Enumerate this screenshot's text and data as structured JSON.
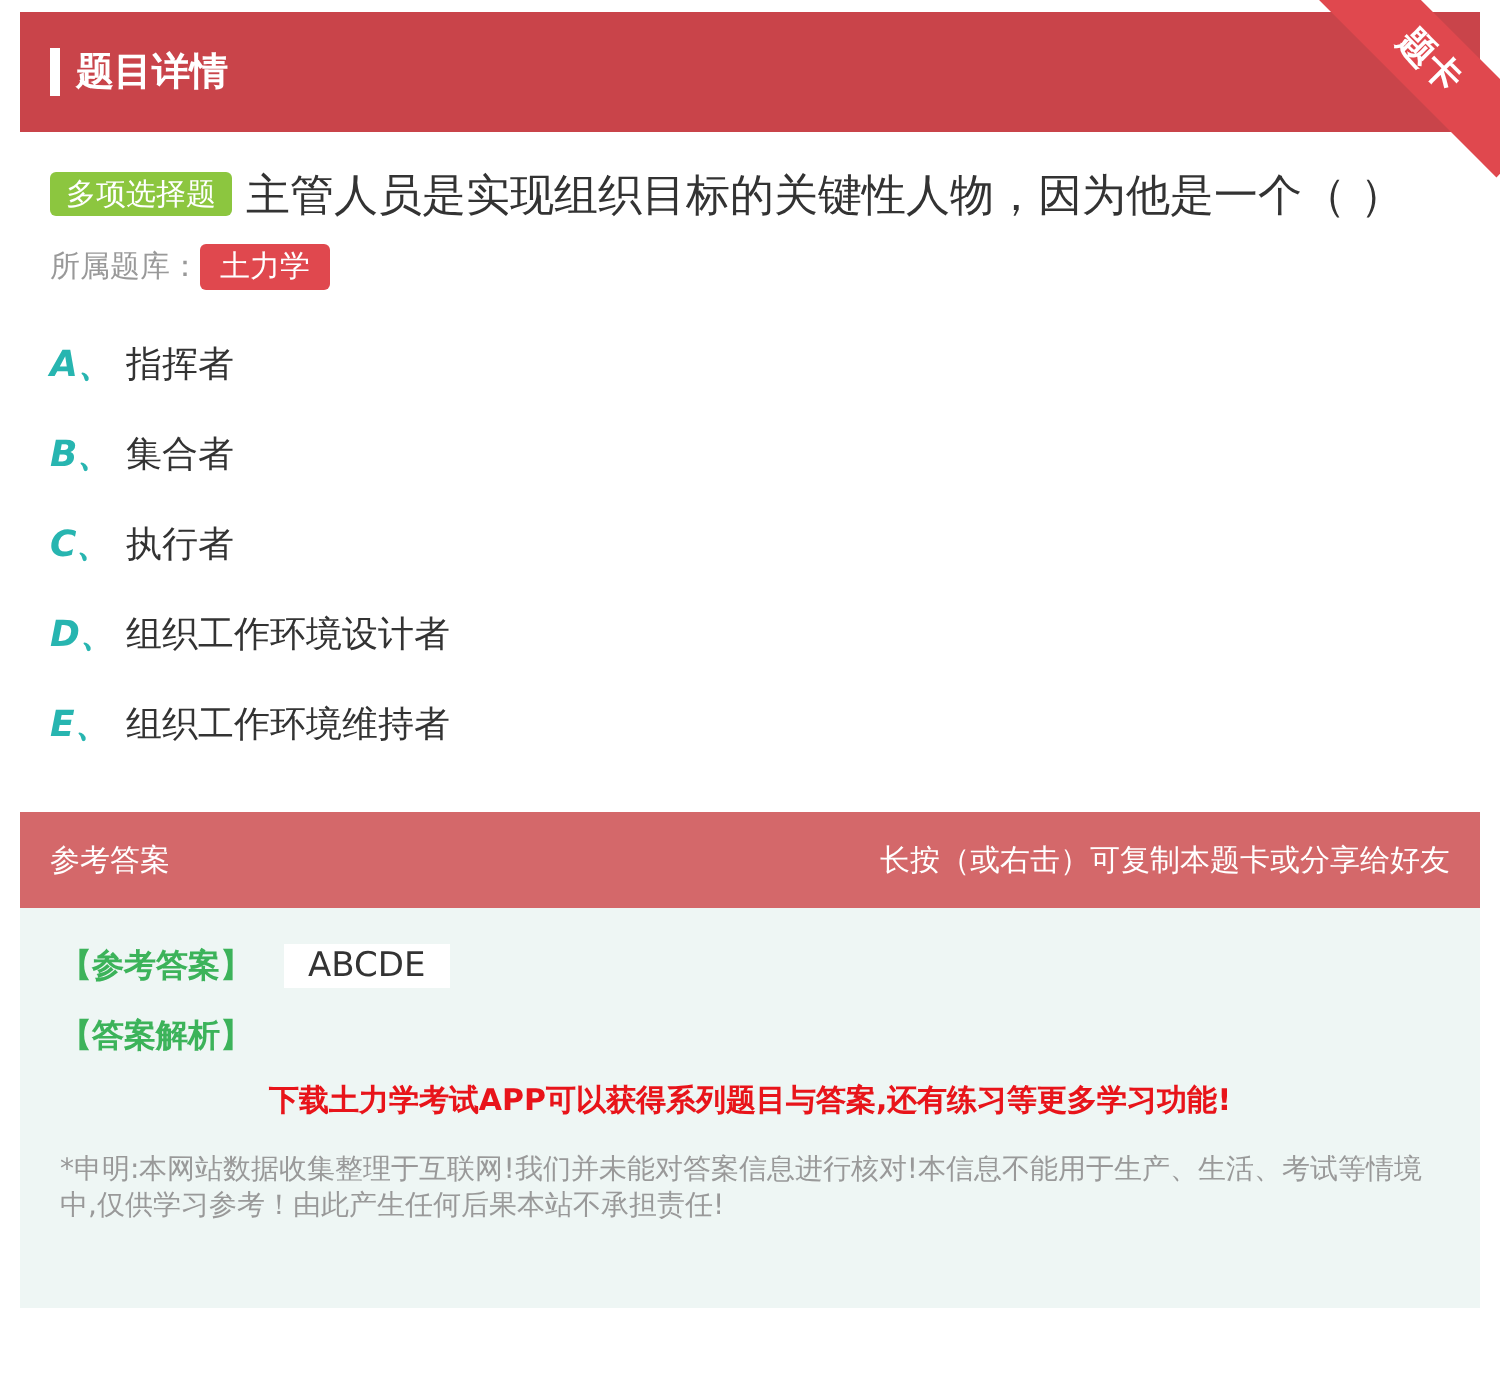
{
  "header": {
    "title": "题目详情",
    "corner_tag": "题卡"
  },
  "question": {
    "type_badge": "多项选择题",
    "text": "主管人员是实现组织目标的关键性人物，因为他是一个（ ）",
    "bank_label": "所属题库：",
    "bank_tag": "土力学"
  },
  "options": [
    {
      "letter": "A、",
      "text": "指挥者"
    },
    {
      "letter": "B、",
      "text": "集合者"
    },
    {
      "letter": "C、",
      "text": "执行者"
    },
    {
      "letter": "D、",
      "text": "组织工作环境设计者"
    },
    {
      "letter": "E、",
      "text": "组织工作环境维持者"
    }
  ],
  "answer_panel": {
    "title": "参考答案",
    "hint": "长按（或右击）可复制本题卡或分享给好友",
    "answer_label": "【参考答案】",
    "answer": "ABCDE",
    "analysis_label": "【答案解析】",
    "promo": "下载土力学考试APP可以获得系列题目与答案,还有练习等更多学习功能!",
    "disclaimer": "*申明:本网站数据收集整理于互联网!我们并未能对答案信息进行核对!本信息不能用于生产、生活、考试等情境中,仅供学习参考！由此产生任何后果本站不承担责任!"
  }
}
